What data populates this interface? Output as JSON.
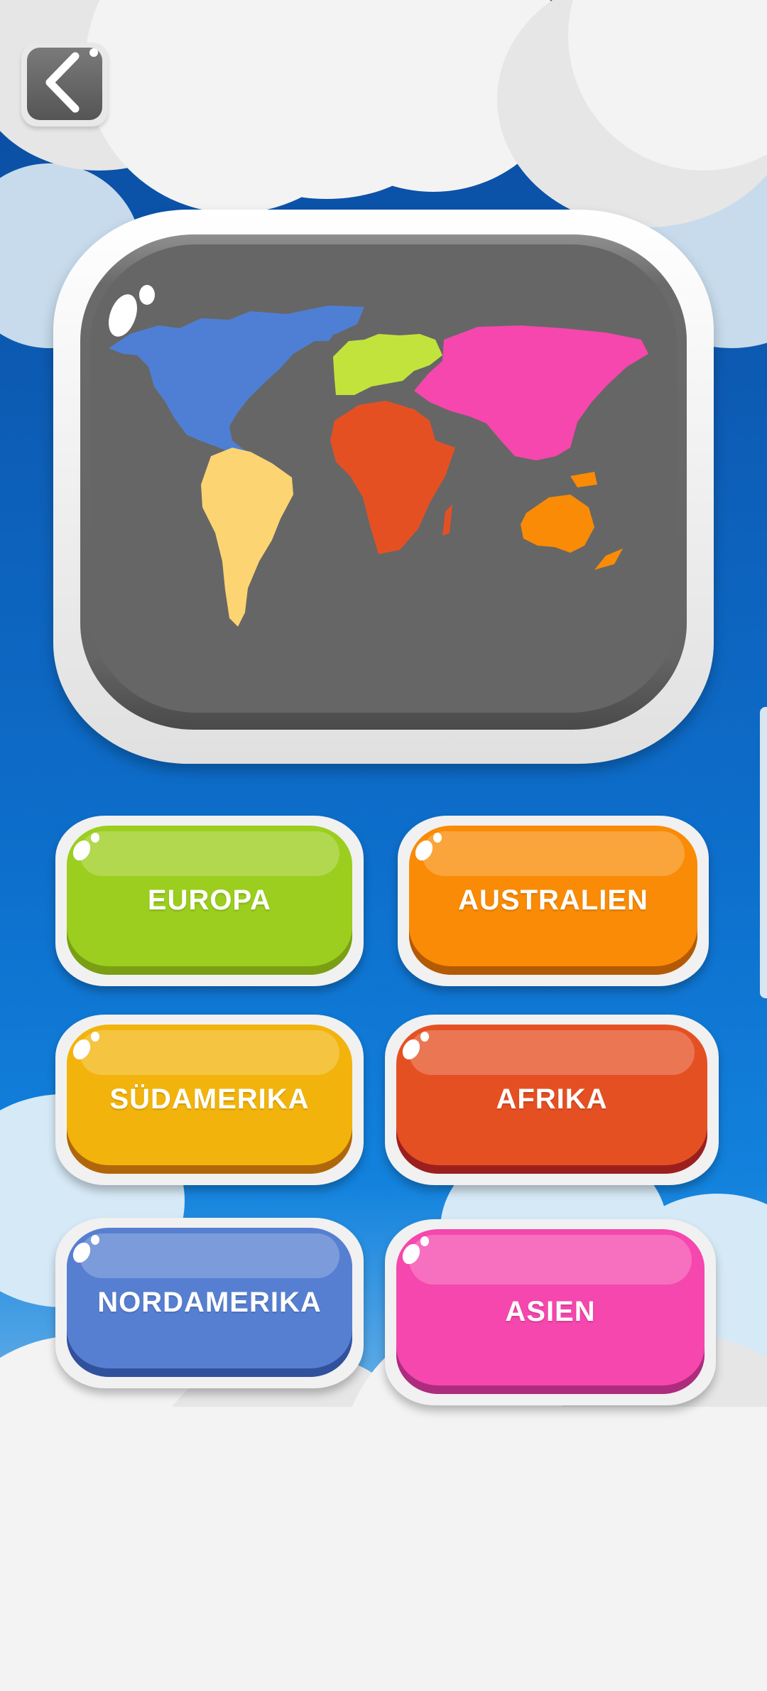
{
  "back_icon": "chevron-left-icon",
  "map": {
    "icon": "world-map"
  },
  "continents": {
    "europa": {
      "label": "EUROPA",
      "color": "#9bce1e",
      "shadow": "#7a9f14"
    },
    "australien": {
      "label": "AUSTRALIEN",
      "color": "#f98b06",
      "shadow": "#b35a06"
    },
    "suedamerika": {
      "label": "SÜDAMERIKA",
      "color": "#f2b40c",
      "shadow": "#b0670b"
    },
    "afrika": {
      "label": "AFRIKA",
      "color": "#e55023",
      "shadow": "#9c1f1f"
    },
    "nordamerika": {
      "label": "NORDAMERIKA",
      "color": "#577fd1",
      "shadow": "#32519c"
    },
    "asien": {
      "label": "ASIEN",
      "color": "#f547ad",
      "shadow": "#ad2c7d"
    }
  }
}
